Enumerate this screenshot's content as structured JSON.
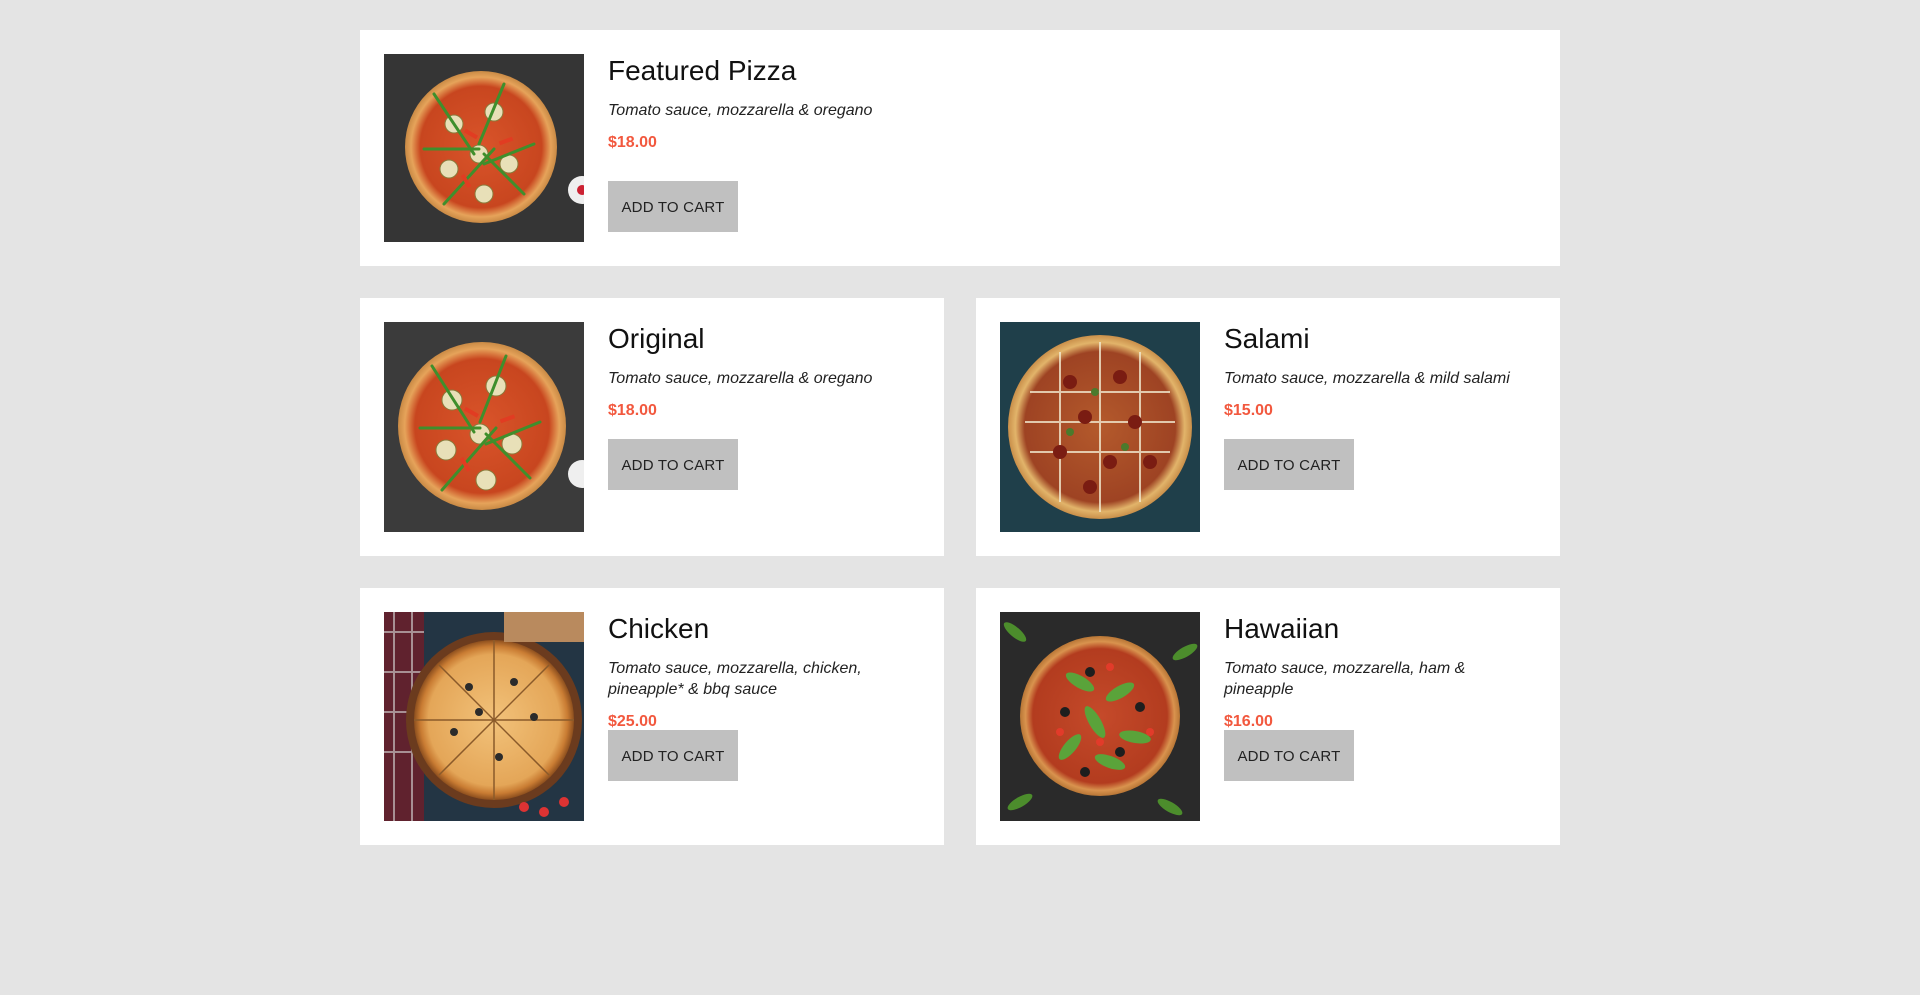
{
  "products": [
    {
      "id": "featured",
      "name": "Featured Pizza",
      "description": "Tomato sauce, mozzarella & oregano",
      "price": "$18.00",
      "button": "ADD TO CART",
      "image": "pizza-vegetable-arugula"
    },
    {
      "id": "original",
      "name": "Original",
      "description": "Tomato sauce, mozzarella & oregano",
      "price": "$18.00",
      "button": "ADD TO CART",
      "image": "pizza-vegetable-arugula"
    },
    {
      "id": "salami",
      "name": "Salami",
      "description": "Tomato sauce, mozzarella & mild salami",
      "price": "$15.00",
      "button": "ADD TO CART",
      "image": "pizza-salami-bbq"
    },
    {
      "id": "chicken",
      "name": "Chicken",
      "description": "Tomato sauce, mozzarella, chicken, pineapple* & bbq sauce",
      "price": "$25.00",
      "button": "ADD TO CART",
      "image": "pizza-chicken-olive"
    },
    {
      "id": "hawaiian",
      "name": "Hawaiian",
      "description": "Tomato sauce, mozzarella, ham & pineapple",
      "price": "$16.00",
      "button": "ADD TO CART",
      "image": "pizza-arugula-tomato"
    }
  ],
  "colors": {
    "background": "#e4e4e4",
    "card": "#ffffff",
    "price": "#f2583e",
    "button": "#c0c0c0"
  }
}
